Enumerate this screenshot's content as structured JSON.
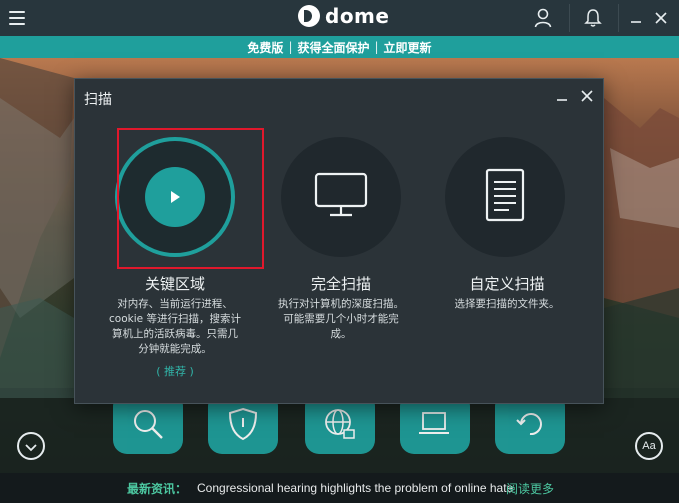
{
  "titlebar": {
    "logo_text": "dome",
    "icons": [
      "hamburger-menu-icon",
      "user-icon",
      "bell-icon",
      "minimize-icon",
      "close-icon"
    ]
  },
  "promo": {
    "free_version": "免费版",
    "get_protection": "获得全面保护",
    "renew_now": "立即更新",
    "separator": "|"
  },
  "dialog": {
    "title": "扫描",
    "options": [
      {
        "title": "关键区域",
        "desc_lines": [
          "对内存、当前运行进程、",
          "cookie 等进行扫描，搜索计",
          "算机上的活跃病毒。只需几",
          "分钟就能完成。"
        ],
        "recommend": "( 推荐 )",
        "icon": "play-icon"
      },
      {
        "title": "完全扫描",
        "desc_lines": [
          "执行对计算机的深度扫描。",
          "可能需要几个小时才能完",
          "成。"
        ],
        "icon": "monitor-icon"
      },
      {
        "title": "自定义扫描",
        "desc_lines": [
          "选择要扫描的文件夹。"
        ],
        "icon": "document-icon"
      }
    ]
  },
  "tiles": [
    "search-icon",
    "shield-icon",
    "globe-lock-icon",
    "devices-icon",
    "refresh-icon"
  ],
  "news": {
    "label": "最新资讯：",
    "headline": "Congressional hearing highlights the problem of online hate",
    "more": "阅读更多"
  },
  "font_button_label": "Aa",
  "colors": {
    "accent": "#1f9f9c",
    "dialog_bg": "#2b3338",
    "titlebar_bg": "#28363d",
    "highlight": "#e0182c",
    "news_label": "#4cc7a0"
  }
}
